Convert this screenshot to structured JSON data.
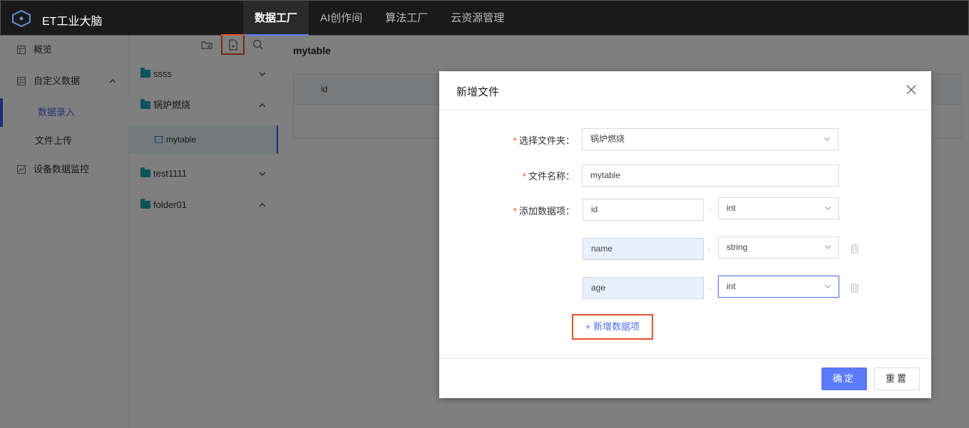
{
  "topbar": {
    "brand": "ET工业大脑",
    "nav": [
      "数据工厂",
      "AI创作间",
      "算法工厂",
      "云资源管理"
    ],
    "active_nav": "数据工厂"
  },
  "sidebar": {
    "overview": "概览",
    "custom_data": "自定义数据",
    "data_entry": "数据录入",
    "file_upload": "文件上传",
    "device_monitor": "设备数据监控"
  },
  "tree": {
    "folders": [
      "ssss",
      "锅炉燃烧",
      "test1111",
      "folder01"
    ],
    "file": "mytable"
  },
  "main": {
    "title": "mytable",
    "column": "id"
  },
  "modal": {
    "title": "新增文件",
    "folder_label": "选择文件夹：",
    "folder_value": "锅炉燃烧",
    "name_label": "文件名称：",
    "name_value": "mytable",
    "items_label": "添加数据项：",
    "items": [
      {
        "name": "id",
        "type": "int"
      },
      {
        "name": "name",
        "type": "string"
      },
      {
        "name": "age",
        "type": "int"
      }
    ],
    "separator": "-",
    "add_item": "+ 新增数据项",
    "ok": "确定",
    "reset": "重置"
  },
  "colors": {
    "accent": "#5b7bfa",
    "highlight": "#e8512b",
    "folder": "#19a6b8"
  }
}
